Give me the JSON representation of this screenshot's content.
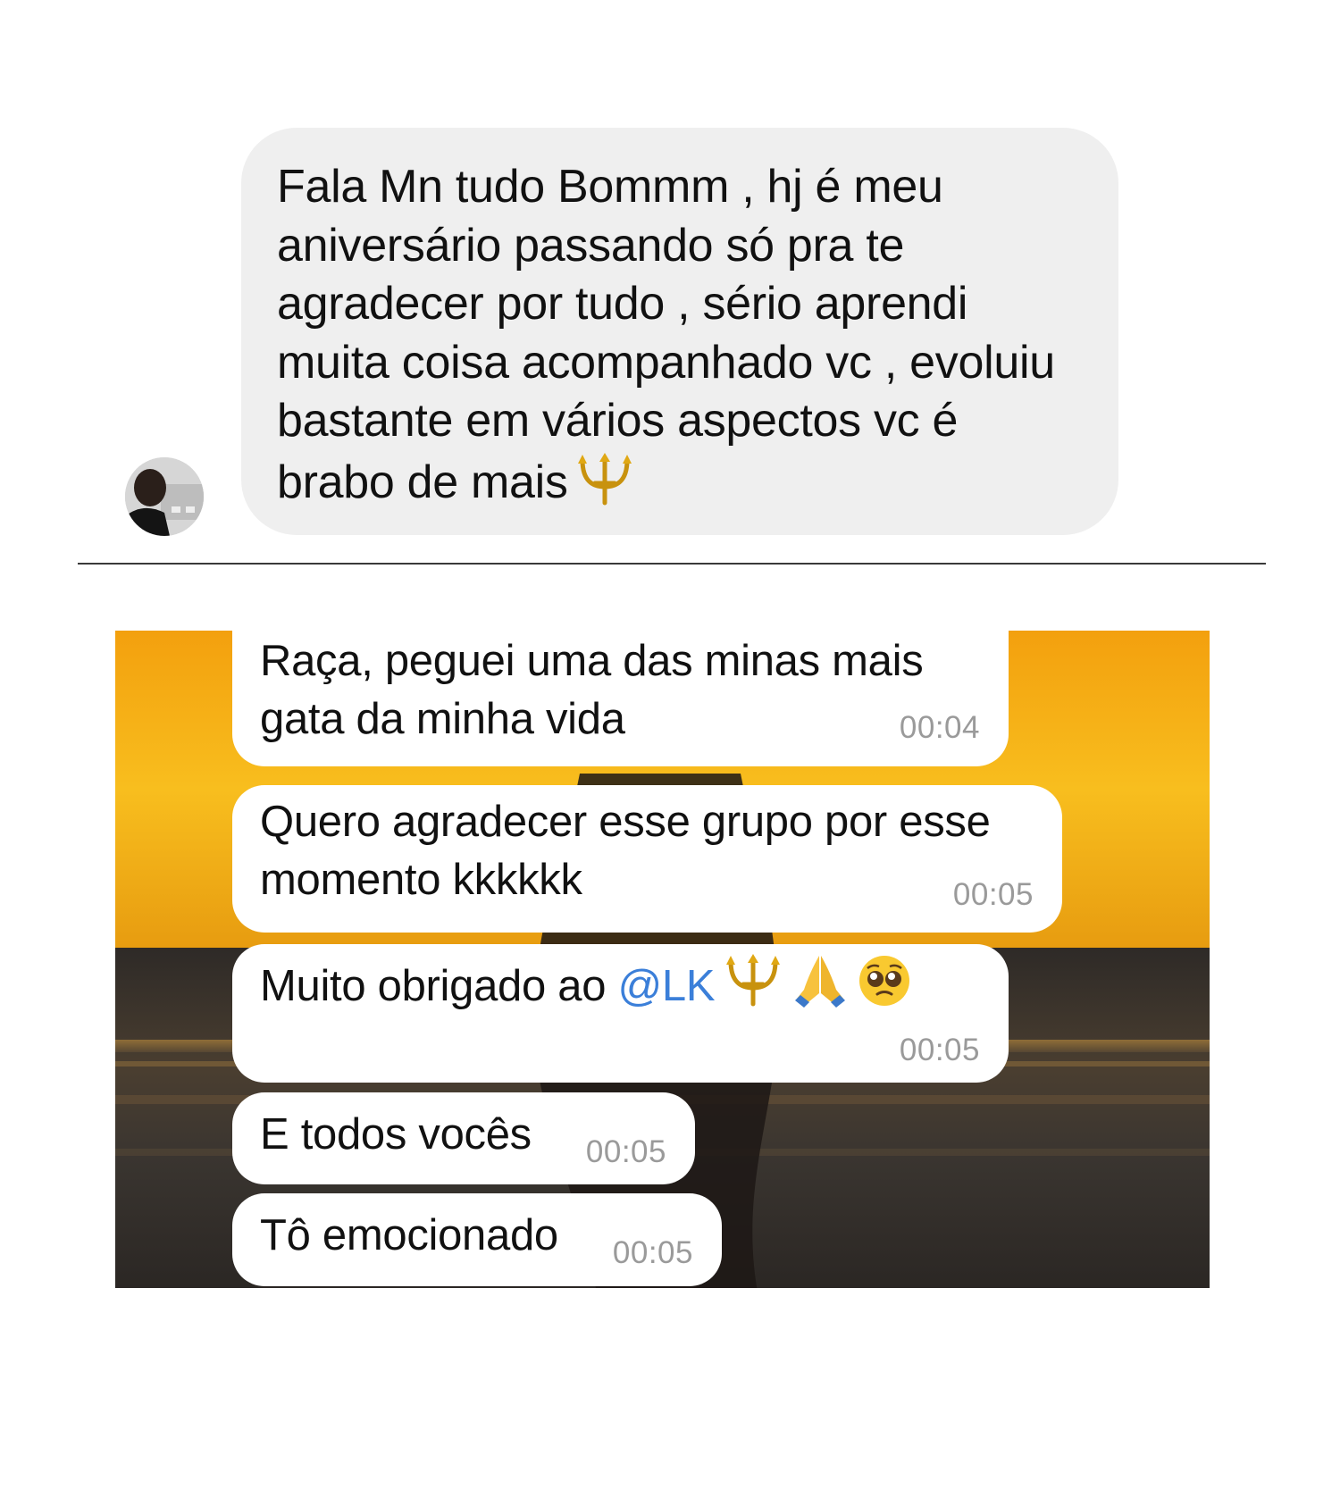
{
  "dm": {
    "message_lines": [
      "Fala Mn tudo Bommm , hj é meu",
      "aniversário passando só pra te",
      "agradecer por tudo , sério aprendi",
      "muita coisa acompanhado vc , evoluiu",
      "bastante em vários aspectos vc é",
      "brabo de mais"
    ],
    "end_emoji": "trident-emoji"
  },
  "group_chat": {
    "messages": [
      {
        "lines": [
          "Raça, peguei uma das minas mais",
          "gata da minha vida"
        ],
        "time": "00:04"
      },
      {
        "lines": [
          "Quero agradecer esse grupo por esse",
          "momento kkkkkk"
        ],
        "time": "00:05"
      },
      {
        "text_before_mention": "Muito obrigado ao ",
        "mention": "@LK",
        "emojis": [
          "trident-emoji",
          "folded-hands-emoji",
          "pleading-face-emoji"
        ],
        "time": "00:05"
      },
      {
        "text": "E todos vocês",
        "time": "00:05"
      },
      {
        "text": "Tô emocionado",
        "time": "00:05"
      }
    ],
    "colors": {
      "bubble": "#ffffff",
      "timestamp": "#9a9a9a",
      "mention": "#3b7fd9",
      "sky": "#f5b314"
    }
  }
}
